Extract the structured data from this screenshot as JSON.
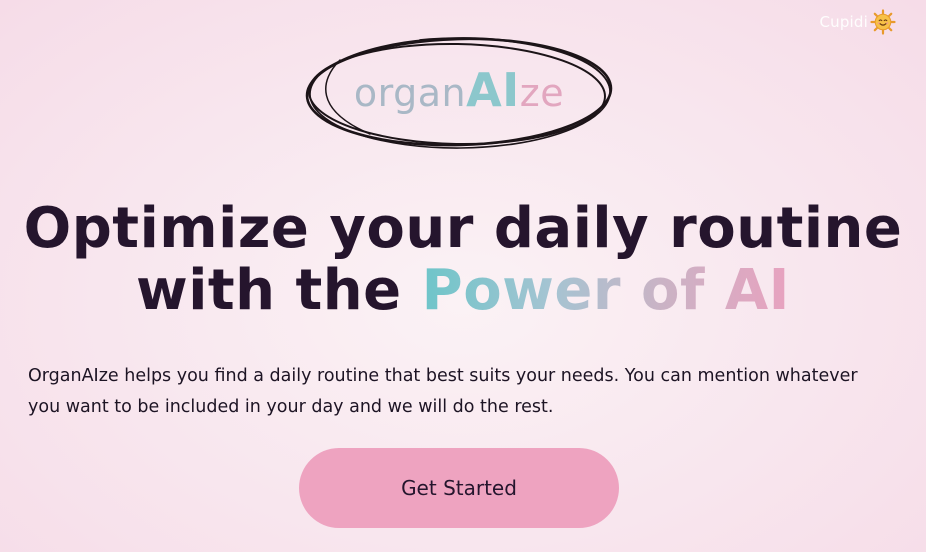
{
  "header": {
    "user_name": "Cupidi",
    "user_icon": "smiling-sun-icon"
  },
  "logo": {
    "part1": "organ",
    "part2": "AI",
    "part3": "ze",
    "decoration_icon": "scribble-circle-icon"
  },
  "hero": {
    "title_line1": "Optimize your daily routine",
    "title_line2_plain": "with the",
    "title_line2_accent": "Power of AI",
    "description": "OrganAIze helps you find a daily routine that best suits your needs. You can mention whatever you want to be included in your day and we will do the rest.",
    "cta_label": "Get Started"
  },
  "colors": {
    "background": "#f8e6ee",
    "title": "#25152d",
    "button": "#eea3c0",
    "accent_start": "#6ec5c9",
    "accent_end": "#e8a2bf"
  }
}
